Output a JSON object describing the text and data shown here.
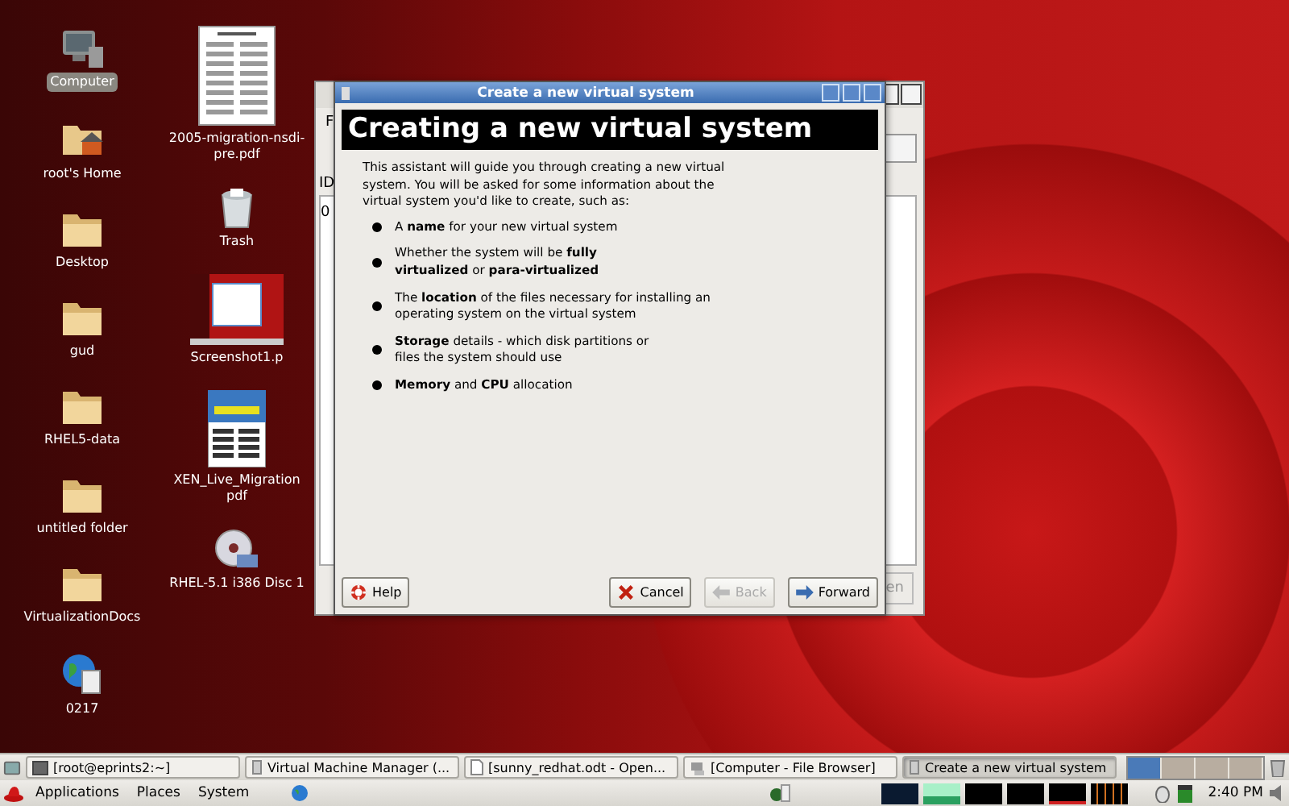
{
  "desktop_icons": [
    [
      {
        "label": "Computer",
        "kind": "computer",
        "selected": true
      },
      {
        "label": "root's Home",
        "kind": "home",
        "selected": false
      },
      {
        "label": "Desktop",
        "kind": "folder",
        "selected": false
      },
      {
        "label": "gud",
        "kind": "folder",
        "selected": false
      },
      {
        "label": "RHEL5-data",
        "kind": "folder",
        "selected": false
      },
      {
        "label": "untitled folder",
        "kind": "folder",
        "selected": false
      },
      {
        "label": "VirtualizationDocs",
        "kind": "folder",
        "selected": false
      },
      {
        "label": "0217",
        "kind": "web",
        "selected": false
      }
    ],
    [
      {
        "label": "2005-migration-nsdi- pre.pdf",
        "kind": "document",
        "selected": false
      },
      {
        "label": "Trash",
        "kind": "trash",
        "selected": false
      },
      {
        "label": "Screenshot1.p",
        "kind": "screenshot",
        "selected": false
      },
      {
        "label": "XEN_Live_Migration pdf",
        "kind": "magazine",
        "selected": false
      },
      {
        "label": "RHEL-5.1 i386 Disc 1",
        "kind": "cdrom",
        "selected": false
      }
    ]
  ],
  "background_window": {
    "menu": "F",
    "column": "ID",
    "cell": "0",
    "button": "en"
  },
  "dialog": {
    "title": "Create a new virtual system",
    "heading": "Creating a new virtual system",
    "intro": "This assistant will guide you through creating a new virtual system. You will be asked for some information about the virtual system you'd like to create, such as:",
    "bullets": [
      "A **name** for your new virtual system",
      "Whether the system will be **fully**\n**virtualized** or **para-virtualized**",
      "The **location** of the files necessary for installing an operating system on the virtual system",
      "**Storage** details - which disk partitions or\nfiles the system should use",
      "**Memory** and **CPU** allocation"
    ],
    "buttons": [
      {
        "label": "Help",
        "kind": "help",
        "disabled": false
      },
      {
        "label": "Cancel",
        "kind": "cancel",
        "disabled": false
      },
      {
        "label": "Back",
        "kind": "back",
        "disabled": true
      },
      {
        "label": "Forward",
        "kind": "forward",
        "disabled": false
      }
    ]
  },
  "window_list": [
    {
      "label": "[root@eprints2:~]",
      "kind": "terminal",
      "selected": false
    },
    {
      "label": "Virtual Machine Manager (...",
      "kind": "app",
      "selected": false
    },
    {
      "label": "[sunny_redhat.odt - Open...",
      "kind": "doc",
      "selected": false
    },
    {
      "label": "[Computer - File Browser]",
      "kind": "files",
      "selected": false
    },
    {
      "label": "Create a new virtual system",
      "kind": "app",
      "selected": true
    }
  ],
  "workspaces": [
    {
      "selected": true
    },
    {
      "selected": false
    },
    {
      "selected": false
    },
    {
      "selected": false
    }
  ],
  "menu_bar": [
    "Applications",
    "Places",
    "System"
  ],
  "clock": "2:40 PM"
}
